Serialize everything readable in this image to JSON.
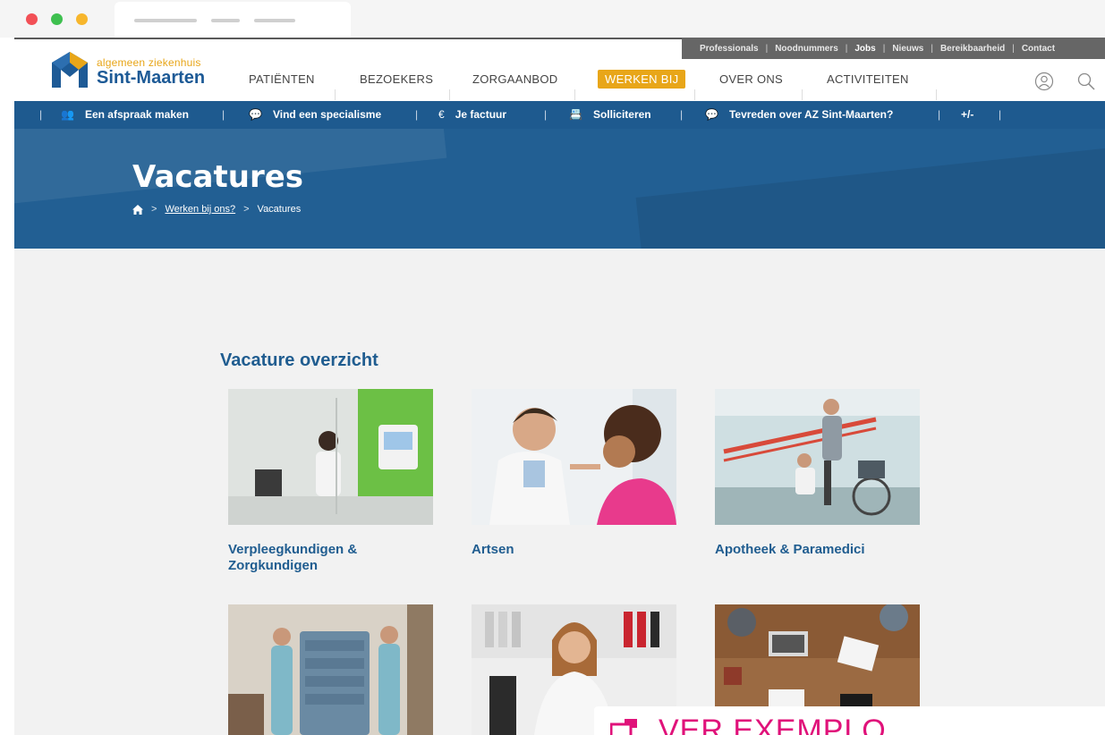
{
  "browser": {
    "dots": [
      "close",
      "minimize",
      "zoom"
    ]
  },
  "utility_nav": {
    "items": [
      "Professionals",
      "Noodnummers",
      "Jobs",
      "Nieuws",
      "Bereikbaarheid",
      "Contact"
    ]
  },
  "logo": {
    "tagline": "algemeen ziekenhuis",
    "name": "Sint-Maarten"
  },
  "main_nav": {
    "items": [
      "PATIËNTEN",
      "BEZOEKERS",
      "ZORGAANBOD",
      "WERKEN BIJ",
      "OVER ONS",
      "ACTIVITEITEN"
    ],
    "active": "WERKEN BIJ"
  },
  "quick_nav": {
    "items": [
      {
        "icon": "people-icon",
        "label": "Een afspraak maken"
      },
      {
        "icon": "chat-icon",
        "label": "Vind een specialisme"
      },
      {
        "icon": "euro-icon",
        "label": "Je factuur"
      },
      {
        "icon": "id-card-icon",
        "label": "Solliciteren"
      },
      {
        "icon": "chat-icon",
        "label": "Tevreden over AZ Sint-Maarten?"
      },
      {
        "icon": "",
        "label": "+/-"
      }
    ]
  },
  "hero": {
    "title": "Vacatures",
    "breadcrumb": {
      "home_icon": "home-icon",
      "link": "Werken bij ons?",
      "current": "Vacatures"
    }
  },
  "content": {
    "section_title": "Vacature overzicht",
    "cards": [
      {
        "title": "Verpleegkundigen & Zorgkundigen"
      },
      {
        "title": "Artsen"
      },
      {
        "title": "Apotheek & Paramedici"
      },
      {
        "title": ""
      },
      {
        "title": ""
      },
      {
        "title": ""
      }
    ]
  },
  "watermark": {
    "text": "VER EXEMPLO"
  },
  "colors": {
    "brand_blue": "#1e5a8f",
    "accent_orange": "#e8a619",
    "heading_blue": "#205d90",
    "watermark_pink": "#e0127a"
  }
}
